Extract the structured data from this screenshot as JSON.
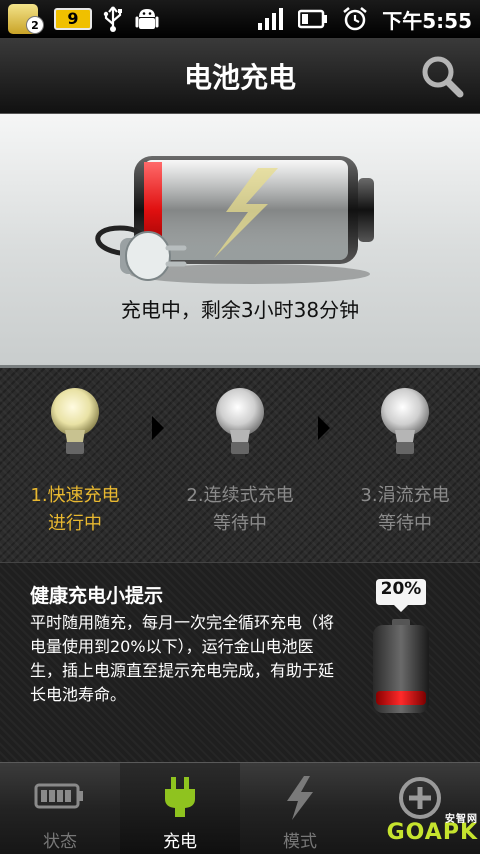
{
  "status_bar": {
    "app_badge": "2",
    "battery_level": "9",
    "time": "下午5:55",
    "icons": [
      "notification-app-icon",
      "battery-icon",
      "usb-icon",
      "android-debug-icon",
      "signal-icon",
      "battery-status-icon",
      "alarm-icon"
    ]
  },
  "header": {
    "title": "电池充电",
    "search_icon": "search-icon"
  },
  "battery": {
    "status_text": "充电中，剩余3小时38分钟",
    "icons": [
      "battery-icon",
      "plug-icon",
      "lightning-icon"
    ]
  },
  "steps": [
    {
      "label": "1.快速充电",
      "state": "进行中",
      "active": true
    },
    {
      "label": "2.连续式充电",
      "state": "等待中",
      "active": false
    },
    {
      "label": "3.涓流充电",
      "state": "等待中",
      "active": false
    }
  ],
  "tip": {
    "title": "健康充电小提示",
    "body": "平时随用随充，每月一次完全循环充电（将电量使用到20%以下），运行金山电池医生，插上电源直至提示充电完成，有助于延长电池寿命。",
    "battery_percent": "20%"
  },
  "nav": {
    "items": [
      {
        "label": "状态",
        "icon": "battery-status-icon"
      },
      {
        "label": "充电",
        "icon": "plug-icon"
      },
      {
        "label": "模式",
        "icon": "lightning-icon"
      },
      {
        "label": "",
        "icon": "plus-icon"
      }
    ],
    "selected": 1
  },
  "watermark": {
    "text": "GOAPK",
    "sub": "安智网"
  },
  "colors": {
    "active_step": "#e8b830",
    "nav_selected": "#ffffff",
    "plug_green": "#8fc31f",
    "battery_red": "#e02020"
  }
}
